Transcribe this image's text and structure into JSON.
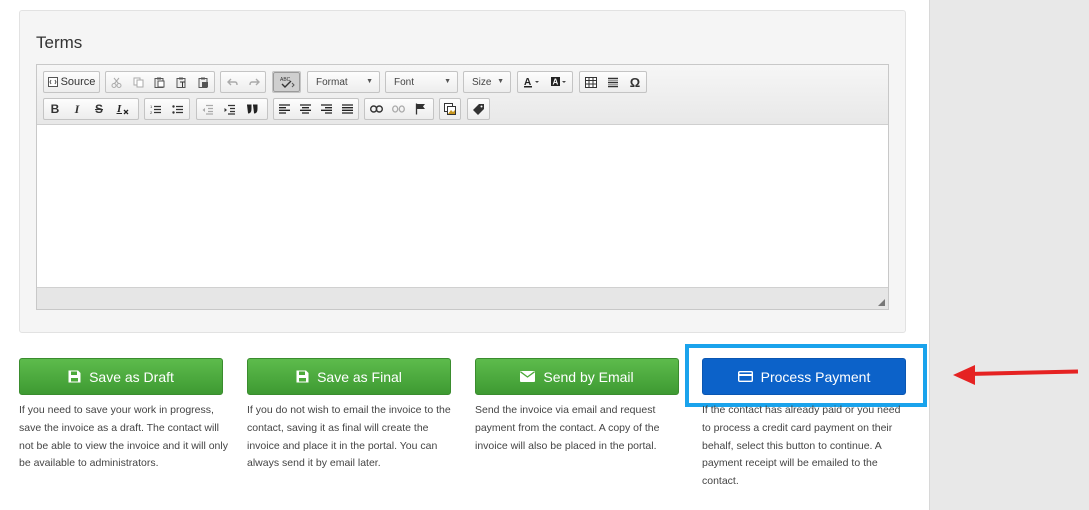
{
  "terms": {
    "title": "Terms",
    "toolbar": {
      "source_label": "Source",
      "format_label": "Format",
      "font_label": "Font",
      "size_label": "Size",
      "bold": "B",
      "italic": "I",
      "strike": "S",
      "remove_format": "Ix",
      "blockquote": "99",
      "special_char": "Ω"
    }
  },
  "actions": {
    "save_draft": {
      "label": "Save as Draft",
      "description": "If you need to save your work in progress, save the invoice as a draft. The contact will not be able to view the invoice and it will only be available to administrators."
    },
    "save_final": {
      "label": "Save as Final",
      "description": "If you do not wish to email the invoice to the contact, saving it as final will create the invoice and place it in the portal. You can always send it by email later."
    },
    "send_email": {
      "label": "Send by Email",
      "description": "Send the invoice via email and request payment from the contact. A copy of the invoice will also be placed in the portal."
    },
    "process_payment": {
      "label": "Process Payment",
      "description": "If the contact has already paid or you need to process a credit card payment on their behalf, select this button to continue. A payment receipt will be emailed to the contact."
    }
  },
  "colors": {
    "green": "#4cae3c",
    "blue": "#0c62c9",
    "highlight": "#1aa3ec",
    "arrow": "#e52222"
  }
}
